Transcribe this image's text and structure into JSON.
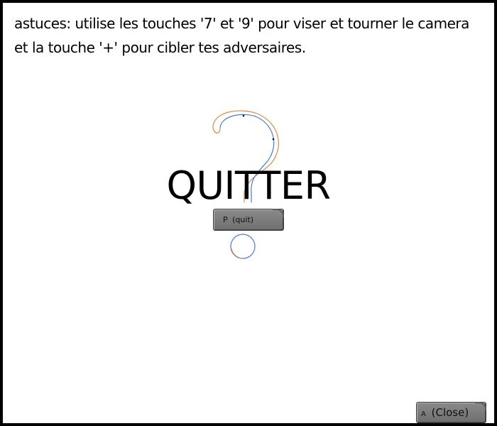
{
  "hint": {
    "text": "astuces: utilise les touches '7' et '9' pour viser et tourner le camera et la touche '+' pour cibler tes adversaires."
  },
  "menu": {
    "title": "QUITTER",
    "icon": "question-mark-icon"
  },
  "buttons": {
    "quit": {
      "key": "P",
      "label": "(quit)"
    },
    "close": {
      "key": "A",
      "label": "(Close)"
    }
  },
  "colors": {
    "border": "#000000",
    "button": "#7a7a7a",
    "icon_stroke_left": "#d98a4a",
    "icon_stroke_right": "#4a7ad9"
  }
}
